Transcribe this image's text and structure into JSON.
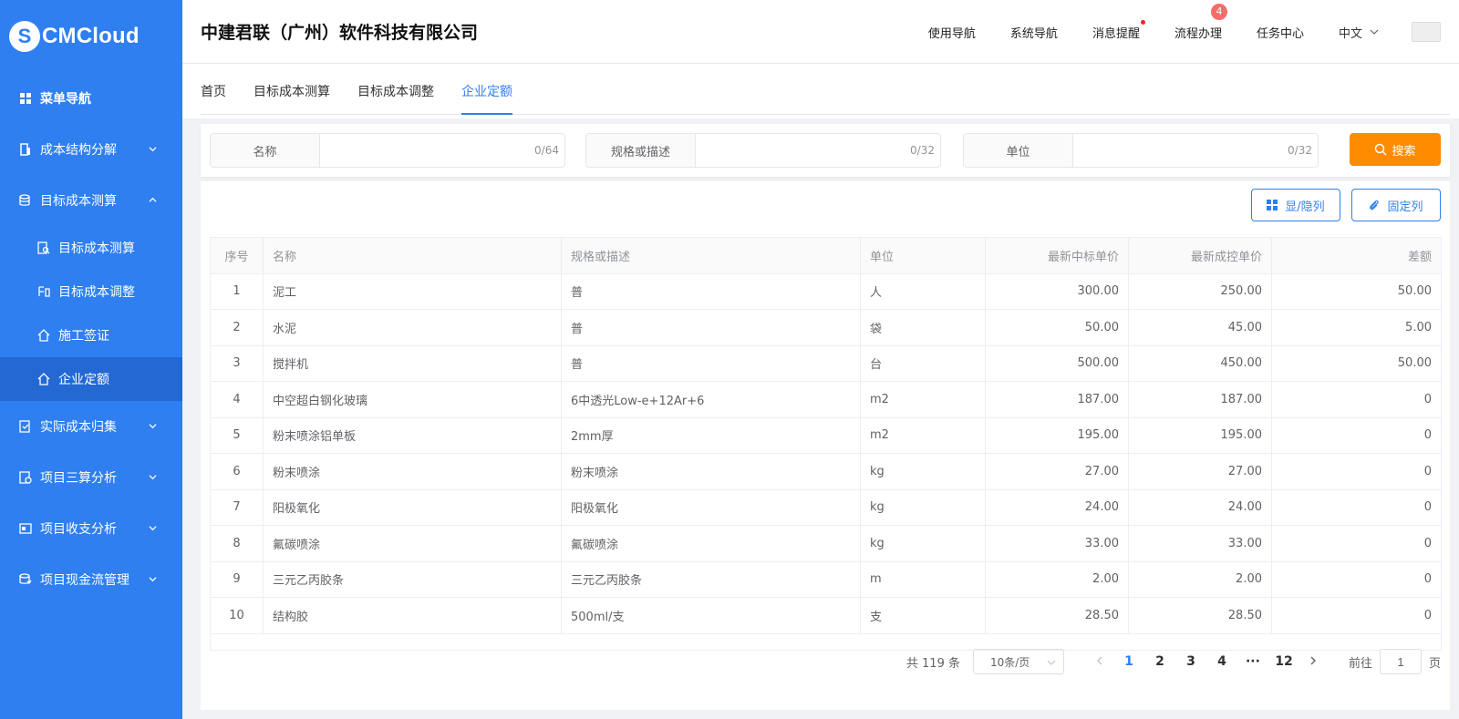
{
  "logo": {
    "mark": "S",
    "text": "CMCloud"
  },
  "sidebar": {
    "items": [
      {
        "label": "菜单导航"
      },
      {
        "label": "成本结构分解"
      },
      {
        "label": "目标成本测算"
      },
      {
        "label": "实际成本归集"
      },
      {
        "label": "项目三算分析"
      },
      {
        "label": "项目收支分析"
      },
      {
        "label": "项目现金流管理"
      }
    ],
    "submenu": [
      {
        "label": "目标成本测算"
      },
      {
        "label": "目标成本调整"
      },
      {
        "label": "施工签证"
      },
      {
        "label": "企业定额"
      }
    ]
  },
  "header": {
    "company": "中建君联（广州）软件科技有限公司",
    "nav": [
      "使用导航",
      "系统导航",
      "消息提醒",
      "流程办理",
      "任务中心"
    ],
    "flow_badge": "4",
    "lang": "中文"
  },
  "tabs": [
    "首页",
    "目标成本测算",
    "目标成本调整",
    "企业定额"
  ],
  "search": {
    "fields": [
      {
        "label": "名称",
        "value": "",
        "count": "0/64"
      },
      {
        "label": "规格或描述",
        "value": "",
        "count": "0/32"
      },
      {
        "label": "单位",
        "value": "",
        "count": "0/32"
      }
    ],
    "button": "搜索"
  },
  "toolbar": {
    "toggle_cols": "显/隐列",
    "fix_cols": "固定列"
  },
  "table": {
    "headers": [
      "序号",
      "名称",
      "规格或描述",
      "单位",
      "最新中标单价",
      "最新成控单价",
      "差额"
    ],
    "rows": [
      [
        "1",
        "泥工",
        "普",
        "人",
        "300.00",
        "250.00",
        "50.00"
      ],
      [
        "2",
        "水泥",
        "普",
        "袋",
        "50.00",
        "45.00",
        "5.00"
      ],
      [
        "3",
        "搅拌机",
        "普",
        "台",
        "500.00",
        "450.00",
        "50.00"
      ],
      [
        "4",
        "中空超白钢化玻璃",
        "6中透光Low-e+12Ar+6",
        "m2",
        "187.00",
        "187.00",
        "0"
      ],
      [
        "5",
        "粉末喷涂铝单板",
        "2mm厚",
        "m2",
        "195.00",
        "195.00",
        "0"
      ],
      [
        "6",
        "粉末喷涂",
        "粉末喷涂",
        "kg",
        "27.00",
        "27.00",
        "0"
      ],
      [
        "7",
        "阳极氧化",
        "阳极氧化",
        "kg",
        "24.00",
        "24.00",
        "0"
      ],
      [
        "8",
        "氟碳喷涂",
        "氟碳喷涂",
        "kg",
        "33.00",
        "33.00",
        "0"
      ],
      [
        "9",
        "三元乙丙胶条",
        "三元乙丙胶条",
        "m",
        "2.00",
        "2.00",
        "0"
      ],
      [
        "10",
        "结构胶",
        "500ml/支",
        "支",
        "28.50",
        "28.50",
        "0"
      ]
    ]
  },
  "pagination": {
    "total": "共 119 条",
    "page_size": "10条/页",
    "pages": [
      "1",
      "2",
      "3",
      "4",
      "···",
      "12"
    ],
    "jump_label": "前往",
    "jump_value": "1",
    "jump_suffix": "页"
  },
  "colors": {
    "primary": "#2f7ff0",
    "search_button": "#ff8c00",
    "badge": "#f56c6c"
  }
}
